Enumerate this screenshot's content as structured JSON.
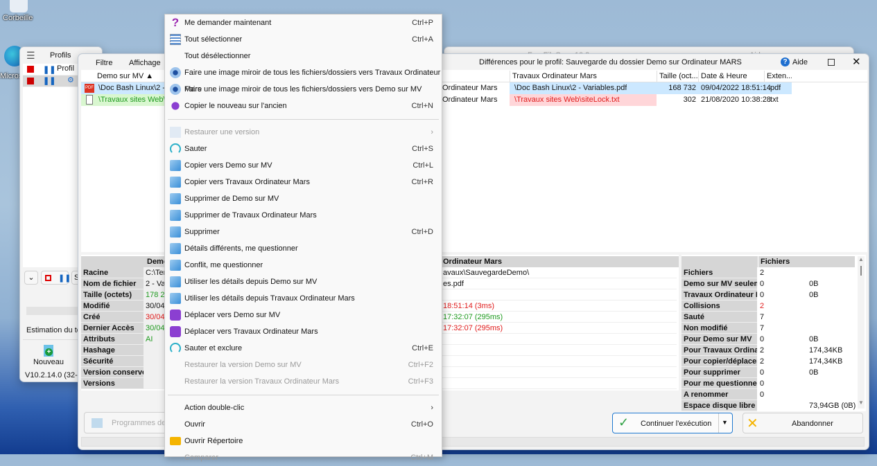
{
  "desktop": {
    "recycle_bin": "Corbeille",
    "edge": "Microso"
  },
  "profiles_window": {
    "menu": [
      "Profils"
    ],
    "column_profile": "Profil",
    "estimate": "Estimation du tem",
    "new_label": "Nouveau",
    "version": "V10.2.14.0 (32-bit)",
    "save_partial": "Sa"
  },
  "back_window": {
    "title_partial": "FreeFileSync 10.2",
    "help": "Aide"
  },
  "diff_window": {
    "title": "Différences pour le profil: Sauvegarde du dossier Demo sur Ordinateur MARS",
    "help": "Aide",
    "menu": [
      "Filtre",
      "Affichage"
    ],
    "columns": {
      "left": "Demo sur MV",
      "right": "Travaux Ordinateur Mars",
      "size": "Taille (oct...",
      "date": "Date & Heure",
      "ext": "Exten..."
    },
    "rows": [
      {
        "left": "\\Doc Bash Linux\\2 - Va",
        "mid": "Ordinateur Mars",
        "right": "\\Doc Bash Linux\\2 - Variables.pdf",
        "size": "168 732",
        "date": "09/04/2022 18:51:14",
        "ext": ".pdf",
        "icon": "pdf-icon"
      },
      {
        "left": "\\Travaux sites Web\\site",
        "mid": "Ordinateur Mars",
        "right": "\\Travaux sites Web\\siteLock.txt",
        "size": "302",
        "date": "21/08/2020 10:38:28",
        "ext": ".txt",
        "icon": "text-file-icon"
      }
    ],
    "details": {
      "header_left": "Demo",
      "header_right": "Ordinateur Mars",
      "rows": [
        {
          "label": "Racine",
          "left": "C:\\Tem",
          "right": "avaux\\SauvegardeDemo\\"
        },
        {
          "label": "Nom de fichier",
          "left": "2 - Var",
          "right": "es.pdf"
        },
        {
          "label": "Taille (octets)",
          "left": "178 217",
          "right": ""
        },
        {
          "label": "Modifié",
          "left": "30/04/",
          "right": "18:51:14 (3ms)"
        },
        {
          "label": "Créé",
          "left": "30/04/",
          "right": "17:32:07 (295ms)"
        },
        {
          "label": "Dernier Accès",
          "left": "30/04/",
          "right": "17:32:07 (295ms)"
        },
        {
          "label": "Attributs",
          "left": "AI",
          "right": ""
        },
        {
          "label": "Hashage",
          "left": "",
          "right": ""
        },
        {
          "label": "Sécurité",
          "left": "",
          "right": ""
        },
        {
          "label": "Version conservée",
          "left": "",
          "right": ""
        },
        {
          "label": "Versions",
          "left": "",
          "right": ""
        }
      ]
    },
    "stats": {
      "header": "Fichiers",
      "rows": [
        {
          "label": "Fichiers",
          "files": "2",
          "size": ""
        },
        {
          "label": "Demo sur MV seulement",
          "files": "0",
          "size": "0B"
        },
        {
          "label": "Travaux Ordinateur Mars",
          "files": "0",
          "size": "0B"
        },
        {
          "label": "Collisions",
          "files": "2",
          "size": ""
        },
        {
          "label": "Sauté",
          "files": "7",
          "size": ""
        },
        {
          "label": "Non modifié",
          "files": "7",
          "size": ""
        },
        {
          "label": "Pour Demo sur MV",
          "files": "0",
          "size": "0B"
        },
        {
          "label": "Pour Travaux Ordinateur Mars",
          "files": "2",
          "size": "174,34KB"
        },
        {
          "label": "Pour copier/déplacer",
          "files": "2",
          "size": "174,34KB"
        },
        {
          "label": "Pour supprimer",
          "files": "0",
          "size": "0B"
        },
        {
          "label": "Pour me questionner",
          "files": "0",
          "size": ""
        },
        {
          "label": "A renommer",
          "files": "0",
          "size": ""
        },
        {
          "label": "Espace disque libre (Demo",
          "files": "",
          "size": "73,94GB (0B)"
        }
      ]
    },
    "programs_button": "Programmes de C",
    "continue_button": "Continuer l'exécution",
    "abort_button": "Abandonner"
  },
  "context_menu": {
    "items": [
      {
        "label": "Me demander maintenant",
        "shortcut": "Ctrl+P",
        "icon": "question-icon"
      },
      {
        "label": "Tout sélectionner",
        "shortcut": "Ctrl+A",
        "icon": "select-all-icon"
      },
      {
        "label": "Tout désélectionner",
        "shortcut": "",
        "icon": ""
      },
      {
        "label": "Faire une image miroir de tous les fichiers/dossiers vers Travaux Ordinateur Mars",
        "shortcut": "",
        "icon": "mirror-icon"
      },
      {
        "label": "Faire une image miroir de tous les fichiers/dossiers vers Demo sur MV",
        "shortcut": "",
        "icon": "mirror-icon"
      },
      {
        "label": "Copier le nouveau sur l'ancien",
        "shortcut": "Ctrl+N",
        "icon": "copy-new-icon"
      },
      {
        "sep": true
      },
      {
        "label": "Restaurer une version",
        "shortcut": "",
        "icon": "restore-icon",
        "disabled": true,
        "submenu": true
      },
      {
        "label": "Sauter",
        "shortcut": "Ctrl+S",
        "icon": "skip-icon"
      },
      {
        "label": "Copier vers Demo sur MV",
        "shortcut": "Ctrl+L",
        "icon": "copy-left-icon"
      },
      {
        "label": "Copier vers Travaux Ordinateur Mars",
        "shortcut": "Ctrl+R",
        "icon": "copy-right-icon"
      },
      {
        "label": "Supprimer de Demo sur MV",
        "shortcut": "",
        "icon": "delete-left-icon"
      },
      {
        "label": "Supprimer de Travaux Ordinateur Mars",
        "shortcut": "",
        "icon": "delete-right-icon"
      },
      {
        "label": "Supprimer",
        "shortcut": "Ctrl+D",
        "icon": "delete-both-icon"
      },
      {
        "label": "Détails différents, me questionner",
        "shortcut": "",
        "icon": "ask-details-icon"
      },
      {
        "label": "Conflit, me questionner",
        "shortcut": "",
        "icon": "conflict-icon"
      },
      {
        "label": "Utiliser les détails depuis Demo sur MV",
        "shortcut": "",
        "icon": "details-left-icon"
      },
      {
        "label": "Utiliser les détails depuis Travaux Ordinateur Mars",
        "shortcut": "",
        "icon": "details-right-icon"
      },
      {
        "label": "Déplacer vers Demo sur MV",
        "shortcut": "",
        "icon": "move-left-icon"
      },
      {
        "label": "Déplacer vers Travaux Ordinateur Mars",
        "shortcut": "",
        "icon": "move-right-icon"
      },
      {
        "label": "Sauter et exclure",
        "shortcut": "Ctrl+E",
        "icon": "skip-exclude-icon"
      },
      {
        "label": "Restaurer la version Demo sur MV",
        "shortcut": "Ctrl+F2",
        "icon": "",
        "disabled": true
      },
      {
        "label": "Restaurer la version Travaux Ordinateur Mars",
        "shortcut": "Ctrl+F3",
        "icon": "",
        "disabled": true
      },
      {
        "sep": true
      },
      {
        "label": "Action double-clic",
        "shortcut": "",
        "icon": "",
        "submenu": true
      },
      {
        "label": "Ouvrir",
        "shortcut": "Ctrl+O",
        "icon": ""
      },
      {
        "label": "Ouvrir Répertoire",
        "shortcut": "",
        "icon": "folder-icon"
      },
      {
        "label": "Comparer",
        "shortcut": "Ctrl+M",
        "icon": "",
        "disabled": true
      }
    ]
  },
  "colors": {
    "selection": "#cce8ff",
    "conflict": "#ffd6d9",
    "added": "#d9f7d0",
    "red": "#e01b1b",
    "green": "#1e9a1e"
  }
}
